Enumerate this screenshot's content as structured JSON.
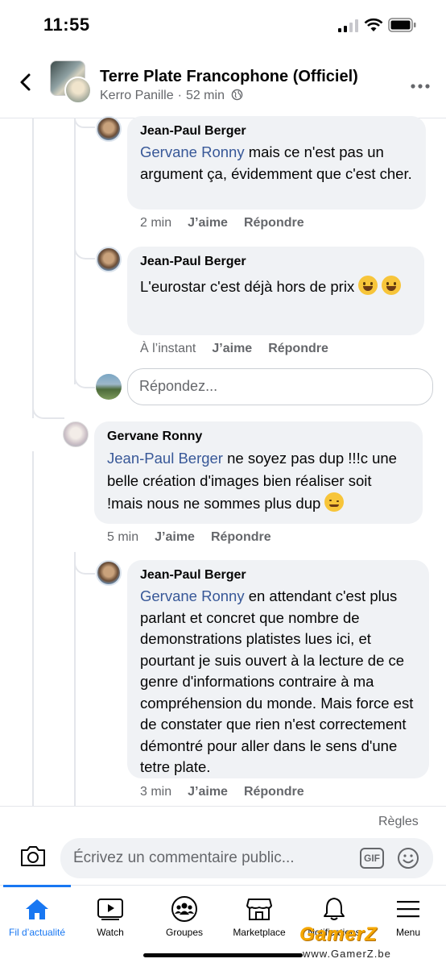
{
  "status_bar": {
    "time": "11:55"
  },
  "header": {
    "back_icon": "chevron-left-icon",
    "group_name": "Terre Plate Francophone (Officiel)",
    "poster": "Kerro Panille",
    "time_ago": "52 min",
    "privacy_icon": "globe-icon",
    "more_icon": "more-dots-icon"
  },
  "comments": [
    {
      "author": "Jean-Paul Berger",
      "mention": "Gervane Ronny",
      "text": " mais ce n'est pas un argument ça, évidemment que c'est cher.",
      "time": "2 min",
      "like": "J’aime",
      "reply": "Répondre"
    },
    {
      "author": "Jean-Paul Berger",
      "text": "L'eurostar c'est déjà hors de prix",
      "time": "À l’instant",
      "like": "J’aime",
      "reply": "Répondre"
    },
    {
      "author": "Gervane Ronny",
      "mention": "Jean-Paul Berger",
      "text": " ne soyez pas dup !!!c une belle création d'images bien réaliser soit !mais nous ne sommes plus dup",
      "time": "5 min",
      "like": "J’aime",
      "reply": "Répondre"
    },
    {
      "author": "Jean-Paul Berger",
      "mention": "Gervane Ronny",
      "text": " en attendant c'est plus parlant et concret que nombre de demonstrations platistes lues ici, et pourtant je suis ouvert à la lecture de ce genre d'informations contraire à ma compréhension du monde. Mais force est de constater que rien n'est correctement démontré pour aller dans le sens d'une tetre plate.",
      "time": "3 min",
      "like": "J’aime",
      "reply": "Répondre"
    }
  ],
  "reply_box": {
    "placeholder": "Répondez..."
  },
  "rules_link": "Règles",
  "composer": {
    "placeholder": "Écrivez un commentaire public...",
    "gif_label": "GIF"
  },
  "tabs": [
    {
      "label": "Fil d’actualité",
      "icon": "home-icon",
      "active": true
    },
    {
      "label": "Watch",
      "icon": "video-icon"
    },
    {
      "label": "Groupes",
      "icon": "groups-icon"
    },
    {
      "label": "Marketplace",
      "icon": "shop-icon"
    },
    {
      "label": "Notifications",
      "icon": "bell-icon"
    },
    {
      "label": "Menu",
      "icon": "menu-icon"
    }
  ],
  "watermark": {
    "brand": "GamerZ",
    "url": "www.GamerZ.be"
  },
  "colors": {
    "accent": "#1877f2",
    "mention": "#385898",
    "bubble": "#f0f2f5"
  }
}
